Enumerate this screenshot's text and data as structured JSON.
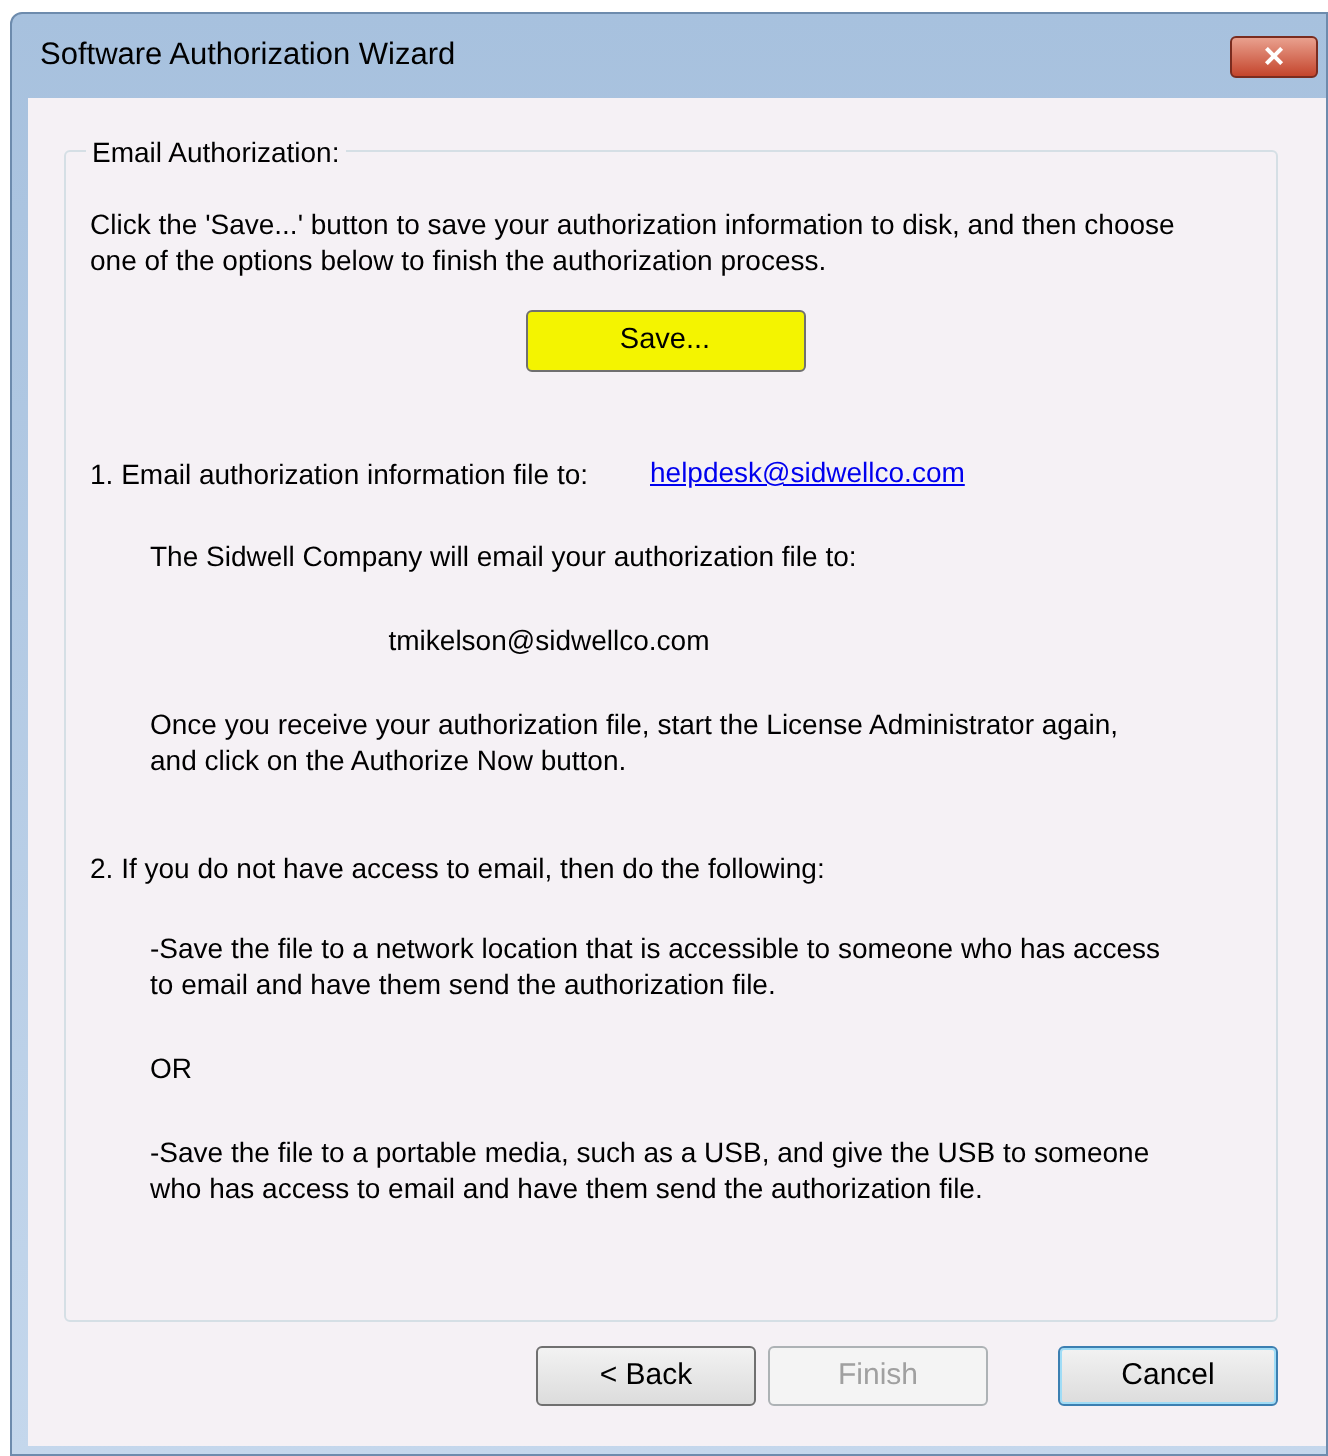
{
  "window": {
    "title": "Software Authorization Wizard",
    "close": "×"
  },
  "group": {
    "title": "Email Authorization:",
    "intro": "Click the 'Save...' button to save your authorization information to disk, and then choose one of the options below to finish the authorization process.",
    "save_button": {
      "label": "Save...",
      "highlighted": true
    },
    "option_1": {
      "label": "1.  Email authorization information file to:",
      "link": "helpdesk@sidwellco.com",
      "paragraphs": [
        {
          "kind": "text",
          "text": "The Sidwell Company will email your authorization file to:"
        },
        {
          "kind": "center",
          "text": "tmikelson@sidwellco.com"
        },
        {
          "kind": "text",
          "text": "Once you receive your authorization file, start the License Administrator again, and click on the Authorize Now button."
        }
      ]
    },
    "option_2": {
      "label": "2.  If you do not have access to email, then do the following:",
      "paragraphs": [
        {
          "kind": "text",
          "text": "-Save the file to a network location that is accessible to someone who has access to email and have them send the authorization file."
        },
        {
          "kind": "text",
          "text": "OR"
        },
        {
          "kind": "text",
          "text": "-Save the file to a portable media, such as a USB, and give the USB to someone who has access to email and have them send the authorization file."
        }
      ]
    }
  },
  "buttons": [
    {
      "label": "< Back",
      "disabled": false,
      "default": false
    },
    {
      "label": "Finish",
      "disabled": true,
      "default": false
    },
    {
      "label": "Cancel",
      "disabled": false,
      "default": true
    }
  ]
}
